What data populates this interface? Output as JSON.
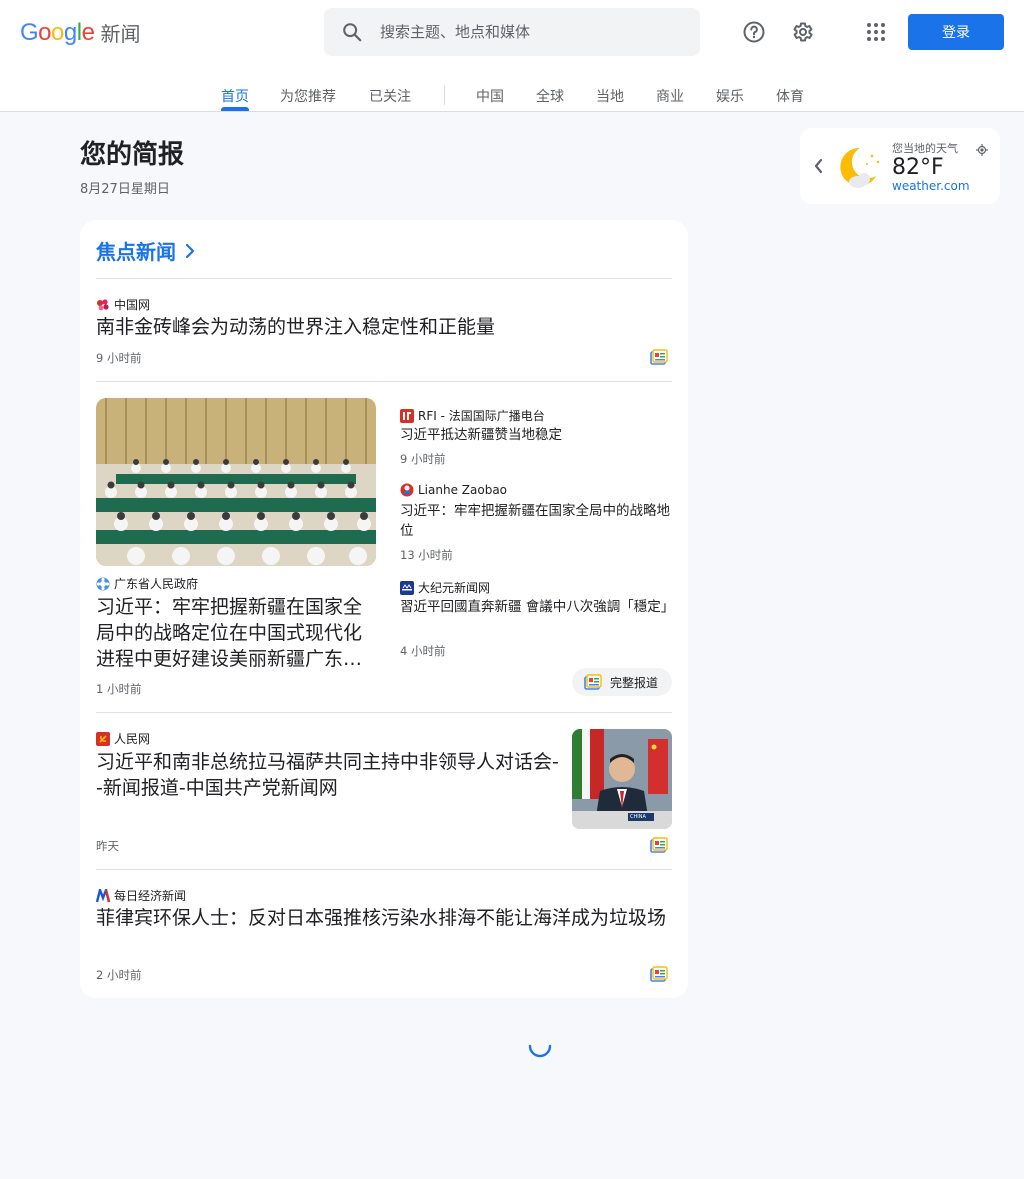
{
  "header": {
    "logo_text": "Google",
    "product_name": "新闻",
    "search_placeholder": "搜索主题、地点和媒体",
    "signin_label": "登录",
    "icons": [
      "help-icon",
      "settings-icon",
      "apps-icon",
      "search-icon"
    ]
  },
  "tabs": [
    {
      "label": "首页",
      "active": true
    },
    {
      "label": "为您推荐"
    },
    {
      "label": "已关注"
    },
    {
      "label": "中国"
    },
    {
      "label": "全球"
    },
    {
      "label": "当地"
    },
    {
      "label": "商业"
    },
    {
      "label": "娱乐"
    },
    {
      "label": "体育"
    }
  ],
  "briefing": {
    "title": "您的简报",
    "date": "8月27日星期日"
  },
  "weather": {
    "label": "您当地的天气",
    "temperature": "82°F",
    "source": "weather.com",
    "condition_icon": "moon-cloud-icon"
  },
  "top_stories": {
    "header": "焦点新闻",
    "stories": [
      {
        "source": "中国网",
        "headline": "南非金砖峰会为动荡的世界注入稳定性和正能量",
        "time": "9 小时前"
      },
      {
        "main": {
          "source": "广东省人民政府",
          "headline": "习近平：牢牢把握新疆在国家全局中的战略定位在中国式现代化进程中更好建设美丽新疆广东…",
          "time": "1 小时前"
        },
        "related": [
          {
            "source": "RFI - 法国国际广播电台",
            "headline": "习近平抵达新疆赞当地稳定",
            "time": "9 小时前"
          },
          {
            "source": "Lianhe Zaobao",
            "headline": "习近平：牢牢把握新疆在国家全局中的战略地位",
            "time": "13 小时前"
          },
          {
            "source": "大纪元新闻网",
            "headline": "習近平回國直奔新疆 會議中八次強調「穩定」",
            "time": "4 小时前"
          }
        ],
        "full_coverage_label": "完整报道"
      },
      {
        "source": "人民网",
        "headline": "习近平和南非总统拉马福萨共同主持中非领导人对话会--新闻报道-中国共产党新闻网",
        "time": "昨天",
        "image_badge": "CHINA"
      },
      {
        "source": "每日经济新闻",
        "headline": "菲律宾环保人士：反对日本强推核污染水排海不能让海洋成为垃圾场",
        "time": "2 小时前"
      }
    ]
  },
  "colors": {
    "accent": "#1a73e8",
    "background": "#f6f8fc"
  }
}
